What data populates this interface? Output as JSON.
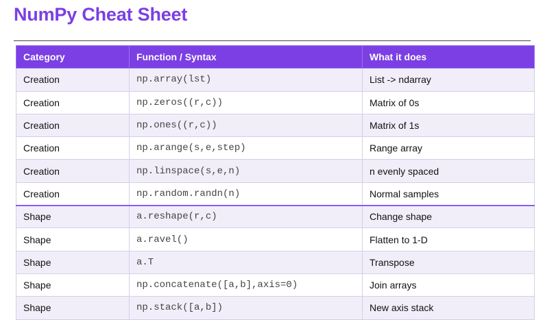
{
  "title": "NumPy Cheat Sheet",
  "accent_color": "#7b3fe4",
  "table": {
    "headers": [
      "Category",
      "Function / Syntax",
      "What it does"
    ],
    "rows": [
      [
        "Creation",
        "np.array(lst)",
        "List -> ndarray"
      ],
      [
        "Creation",
        "np.zeros((r,c))",
        "Matrix of 0s"
      ],
      [
        "Creation",
        "np.ones((r,c))",
        "Matrix of 1s"
      ],
      [
        "Creation",
        "np.arange(s,e,step)",
        "Range array"
      ],
      [
        "Creation",
        "np.linspace(s,e,n)",
        "n evenly spaced"
      ],
      [
        "Creation",
        "np.random.randn(n)",
        "Normal samples"
      ],
      [
        "Shape",
        "a.reshape(r,c)",
        "Change shape"
      ],
      [
        "Shape",
        "a.ravel()",
        "Flatten to 1-D"
      ],
      [
        "Shape",
        "a.T",
        "Transpose"
      ],
      [
        "Shape",
        "np.concatenate([a,b],axis=0)",
        "Join arrays"
      ],
      [
        "Shape",
        "np.stack([a,b])",
        "New axis stack"
      ]
    ]
  }
}
